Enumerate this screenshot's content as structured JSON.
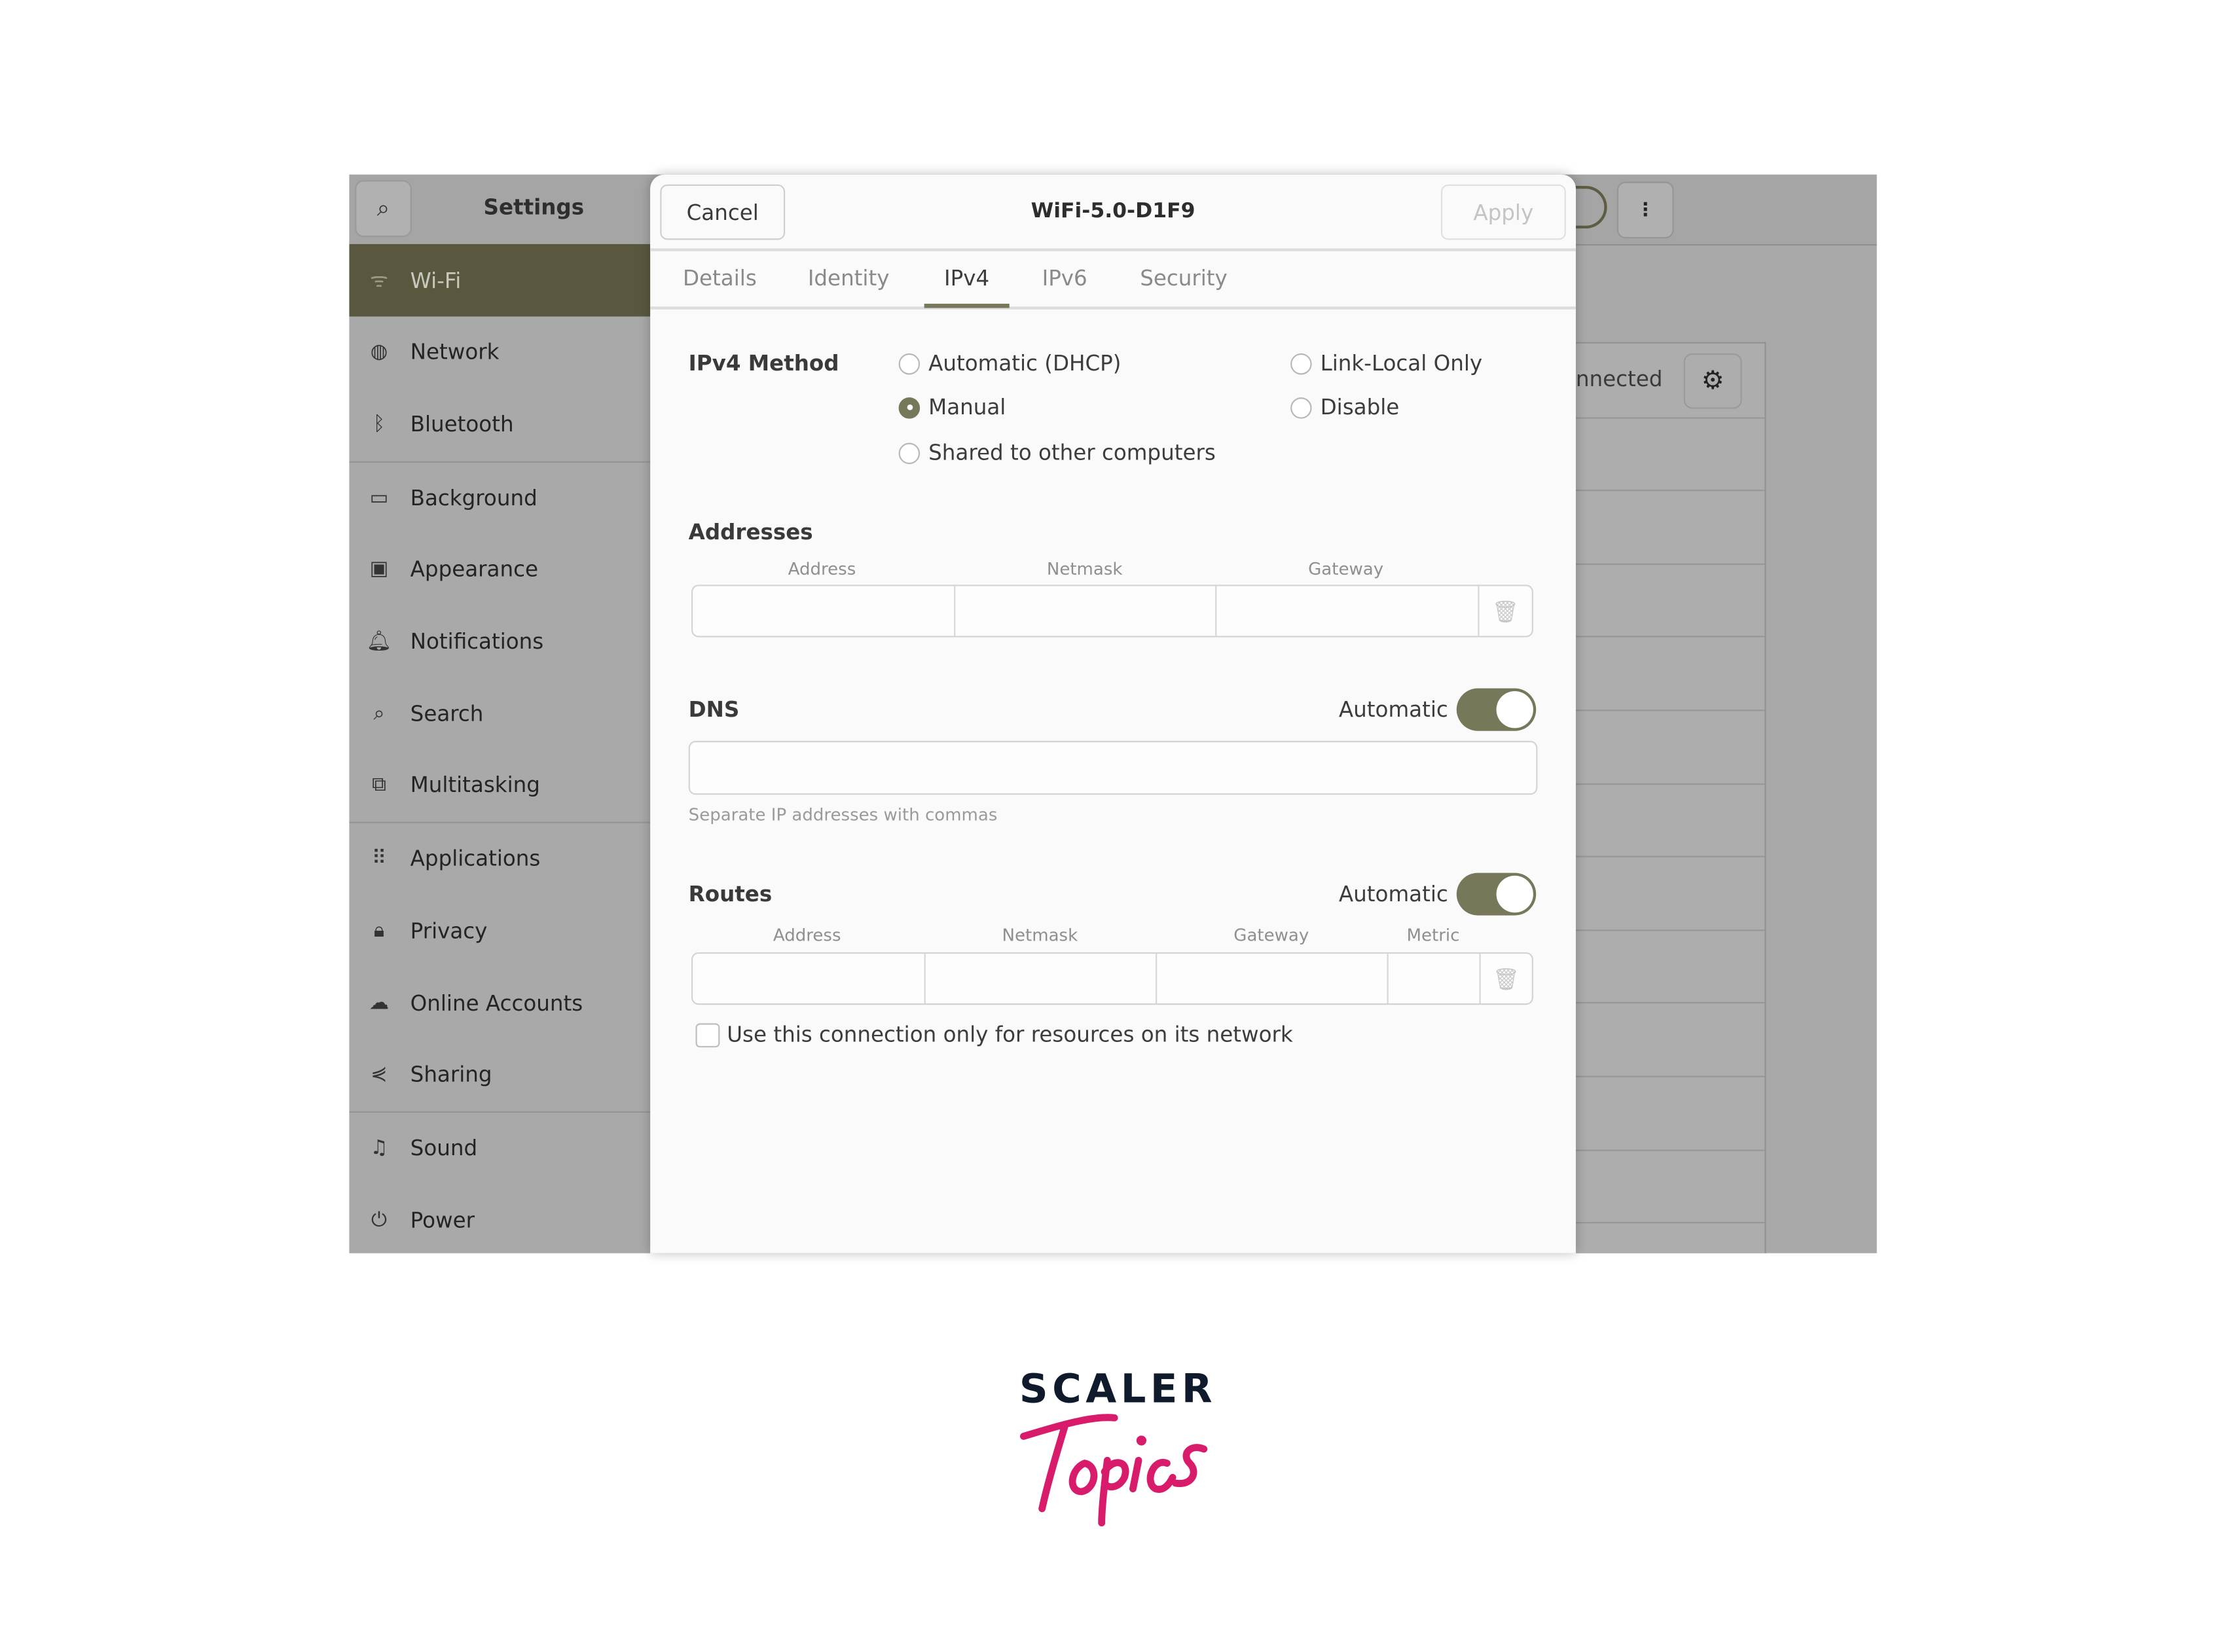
{
  "settings_window": {
    "title": "Settings",
    "search_icon": "search-icon",
    "sidebar": {
      "items": [
        {
          "label": "Wi-Fi",
          "icon": "wifi-icon",
          "glyph": "ᯤ",
          "selected": true
        },
        {
          "label": "Network",
          "icon": "network-globe-icon",
          "glyph": "◍"
        },
        {
          "label": "Bluetooth",
          "icon": "bluetooth-icon",
          "glyph": "ᛒ"
        },
        {
          "label": "Background",
          "icon": "background-display-icon",
          "glyph": "▭"
        },
        {
          "label": "Appearance",
          "icon": "appearance-icon",
          "glyph": "▣"
        },
        {
          "label": "Notifications",
          "icon": "bell-icon",
          "glyph": "🔔︎"
        },
        {
          "label": "Search",
          "icon": "search-icon",
          "glyph": "⌕"
        },
        {
          "label": "Multitasking",
          "icon": "multitasking-icon",
          "glyph": "⧉"
        },
        {
          "label": "Applications",
          "icon": "apps-grid-icon",
          "glyph": "⠿"
        },
        {
          "label": "Privacy",
          "icon": "lock-icon",
          "glyph": "🔒︎"
        },
        {
          "label": "Online Accounts",
          "icon": "cloud-icon",
          "glyph": "☁"
        },
        {
          "label": "Sharing",
          "icon": "share-icon",
          "glyph": "⋞"
        },
        {
          "label": "Sound",
          "icon": "music-note-icon",
          "glyph": "♫"
        },
        {
          "label": "Power",
          "icon": "power-icon",
          "glyph": "⏻"
        }
      ]
    },
    "status_text": "nnected",
    "window_controls": {
      "menu": "⋮",
      "minimize": "–",
      "maximize": "□",
      "close": "✕"
    }
  },
  "dialog": {
    "title": "WiFi-5.0-D1F9",
    "cancel_label": "Cancel",
    "apply_label": "Apply",
    "tabs": [
      {
        "label": "Details"
      },
      {
        "label": "Identity"
      },
      {
        "label": "IPv4",
        "active": true
      },
      {
        "label": "IPv6"
      },
      {
        "label": "Security"
      }
    ],
    "ipv4_method": {
      "label": "IPv4 Method",
      "options": [
        "Automatic (DHCP)",
        "Manual",
        "Shared to other computers",
        "Link-Local Only",
        "Disable"
      ],
      "selected": "Manual"
    },
    "addresses": {
      "label": "Addresses",
      "columns": [
        "Address",
        "Netmask",
        "Gateway"
      ]
    },
    "dns": {
      "label": "DNS",
      "automatic_label": "Automatic",
      "automatic": true,
      "value": "",
      "hint": "Separate IP addresses with commas"
    },
    "routes": {
      "label": "Routes",
      "automatic_label": "Automatic",
      "automatic": true,
      "columns": [
        "Address",
        "Netmask",
        "Gateway",
        "Metric"
      ]
    },
    "only_local_checkbox": {
      "label": "Use this connection only for resources on its network",
      "checked": false
    }
  },
  "colors": {
    "accent": "#77775a",
    "sidebar_selected": "#59583f",
    "logo_dark": "#0f1a2c",
    "logo_pink": "#d81b6a"
  },
  "logo": {
    "line1": "SCALER",
    "line2": "Topics"
  }
}
